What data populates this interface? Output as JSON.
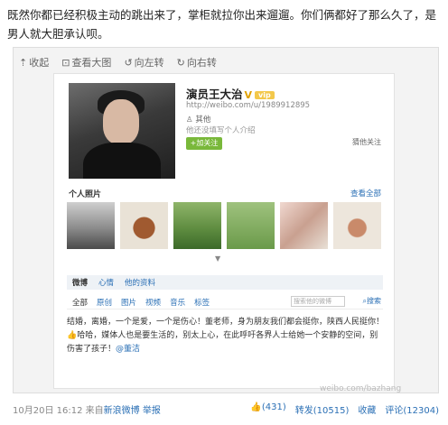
{
  "caption": "既然你都已经积极主动的跳出来了，掌柜就拉你出来遛遛。你们俩都好了那么久了，是男人就大胆承认呗。",
  "toolbar": {
    "collapse": "收起",
    "view_large": "查看大图",
    "rotate_left": "向左转",
    "rotate_right": "向右转"
  },
  "profile": {
    "name": "演员王大治",
    "verified_mark": "V",
    "level_badge": "vip",
    "url": "http://weibo.com/u/1989912895",
    "gender": "其他",
    "intro": "他还没填写个人介绍",
    "follow_button": "+加关注",
    "recommended_follow": "猜他关注"
  },
  "album": {
    "title": "个人照片",
    "view_all": "查看全部"
  },
  "tabs": [
    "微博",
    "心情",
    "他的资料"
  ],
  "filters": [
    "全部",
    "原创",
    "图片",
    "视频",
    "音乐",
    "标签"
  ],
  "search": {
    "placeholder": "搜索他的微博",
    "button": "搜索"
  },
  "post": {
    "text": "结婚，离婚，一个是爱，一个是伤心！董老师，身为朋友我们都会挺你，陕西人民挺你！👍哈哈，媒体人也是要生活的，别太上心，在此呼吁各界人士给她一个安静的空间，别伤害了孩子！",
    "mention": "@董洁"
  },
  "watermark": "weibo.com/bazhang",
  "footer": {
    "timestamp": "10月20日 16:12",
    "from_label": "来自",
    "source": "新浪微博",
    "report": "举报",
    "likes": "(431)",
    "repost": "转发(10515)",
    "favorite": "收藏",
    "comment": "评论(12304)"
  },
  "colors": {
    "link": "#2a6fb5",
    "follow_button": "#79b83a",
    "verified": "#e0a100"
  }
}
